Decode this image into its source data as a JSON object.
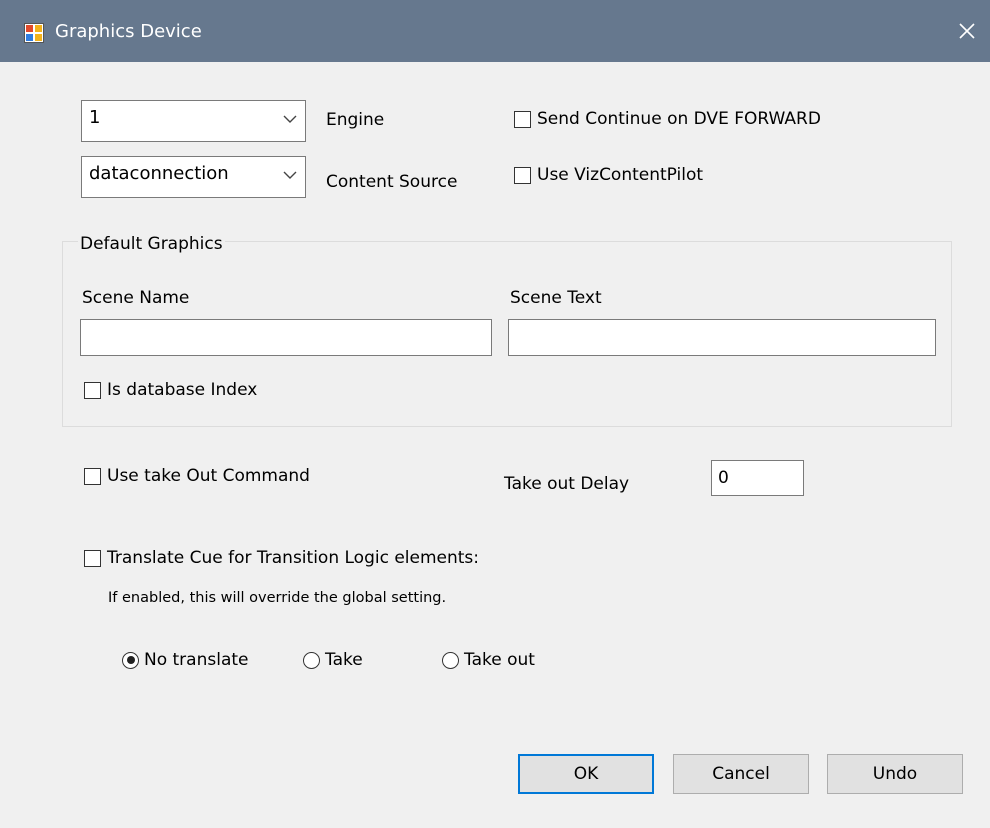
{
  "window": {
    "title": "Graphics Device",
    "close_icon": "close-icon"
  },
  "engine": {
    "value": "1",
    "label": "Engine"
  },
  "content_source": {
    "value": "dataconnection",
    "label": "Content Source"
  },
  "checks": {
    "send_continue": {
      "label": "Send Continue on DVE FORWARD",
      "checked": false
    },
    "use_vizcontentpilot": {
      "label": "Use VizContentPilot",
      "checked": false
    },
    "is_database_index": {
      "label": "Is database Index",
      "checked": false
    },
    "use_take_out": {
      "label": "Use take Out Command",
      "checked": false
    },
    "translate_cue": {
      "label": "Translate Cue for Transition Logic elements:",
      "checked": false
    }
  },
  "default_graphics": {
    "legend": "Default Graphics",
    "scene_name_label": "Scene Name",
    "scene_name_value": "",
    "scene_text_label": "Scene Text",
    "scene_text_value": ""
  },
  "take_out_delay": {
    "label": "Take out Delay",
    "value": "0"
  },
  "translate_note": "If enabled, this will override the global setting.",
  "radios": {
    "no_translate": {
      "label": "No translate",
      "checked": true
    },
    "take": {
      "label": "Take",
      "checked": false
    },
    "take_out": {
      "label": "Take out",
      "checked": false
    }
  },
  "buttons": {
    "ok": "OK",
    "cancel": "Cancel",
    "undo": "Undo"
  },
  "colors": {
    "titlebar": "#66788e",
    "default_button_border": "#0078d7",
    "background": "#f0f0f0"
  }
}
